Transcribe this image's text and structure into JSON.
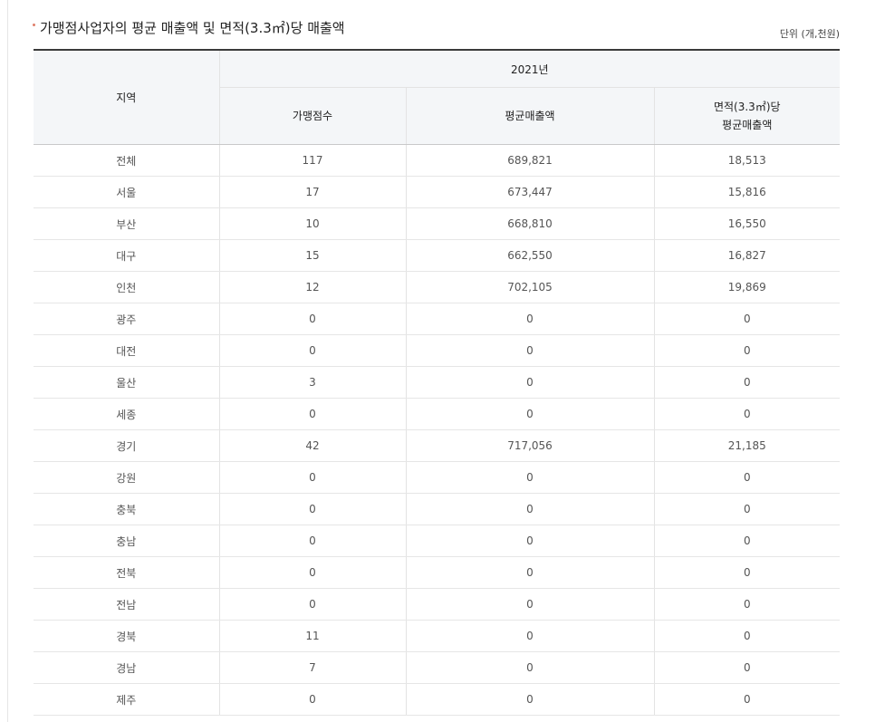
{
  "title": "가맹점사업자의 평균 매출액 및 면적(3.3㎡)당 매출액",
  "unit": "단위 (개,천원)",
  "header": {
    "region": "지역",
    "year": "2021년",
    "col_count": "가맹점수",
    "col_avg_sales": "평균매출액",
    "col_area_sales_line1": "면적(3.3㎡)당",
    "col_area_sales_line2": "평균매출액"
  },
  "rows": [
    {
      "region": "전체",
      "count": "117",
      "avg_sales": "689,821",
      "area_sales": "18,513"
    },
    {
      "region": "서울",
      "count": "17",
      "avg_sales": "673,447",
      "area_sales": "15,816"
    },
    {
      "region": "부산",
      "count": "10",
      "avg_sales": "668,810",
      "area_sales": "16,550"
    },
    {
      "region": "대구",
      "count": "15",
      "avg_sales": "662,550",
      "area_sales": "16,827"
    },
    {
      "region": "인천",
      "count": "12",
      "avg_sales": "702,105",
      "area_sales": "19,869"
    },
    {
      "region": "광주",
      "count": "0",
      "avg_sales": "0",
      "area_sales": "0"
    },
    {
      "region": "대전",
      "count": "0",
      "avg_sales": "0",
      "area_sales": "0"
    },
    {
      "region": "울산",
      "count": "3",
      "avg_sales": "0",
      "area_sales": "0"
    },
    {
      "region": "세종",
      "count": "0",
      "avg_sales": "0",
      "area_sales": "0"
    },
    {
      "region": "경기",
      "count": "42",
      "avg_sales": "717,056",
      "area_sales": "21,185"
    },
    {
      "region": "강원",
      "count": "0",
      "avg_sales": "0",
      "area_sales": "0"
    },
    {
      "region": "충북",
      "count": "0",
      "avg_sales": "0",
      "area_sales": "0"
    },
    {
      "region": "충남",
      "count": "0",
      "avg_sales": "0",
      "area_sales": "0"
    },
    {
      "region": "전북",
      "count": "0",
      "avg_sales": "0",
      "area_sales": "0"
    },
    {
      "region": "전남",
      "count": "0",
      "avg_sales": "0",
      "area_sales": "0"
    },
    {
      "region": "경북",
      "count": "11",
      "avg_sales": "0",
      "area_sales": "0"
    },
    {
      "region": "경남",
      "count": "7",
      "avg_sales": "0",
      "area_sales": "0"
    },
    {
      "region": "제주",
      "count": "0",
      "avg_sales": "0",
      "area_sales": "0"
    }
  ]
}
